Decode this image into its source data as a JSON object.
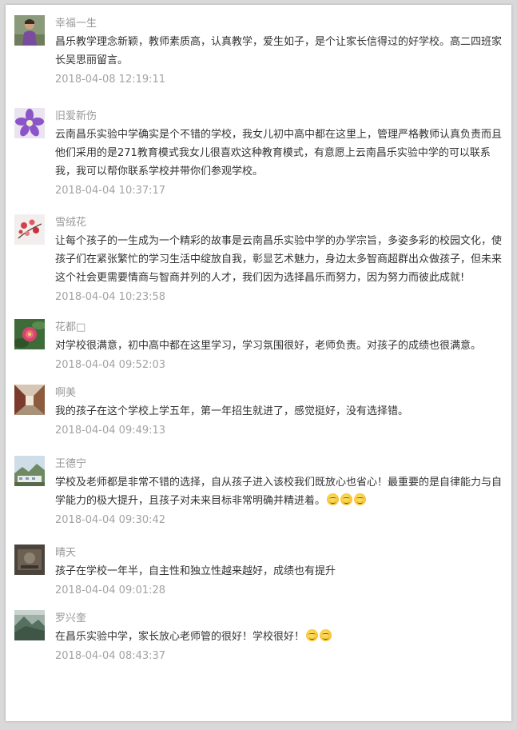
{
  "comments": [
    {
      "name": "幸福一生",
      "text": "昌乐教学理念新颖，教师素质高，认真教学，爱生如子，是个让家长信得过的好学校。高二四班家长吴思丽留言。",
      "time": "2018-04-08 12:19:11",
      "avatar_icon": "child-portrait-avatar"
    },
    {
      "name": "旧爱新伤",
      "text": "云南昌乐实验中学确实是个不错的学校，我女儿初中高中都在这里上，管理严格教师认真负责而且他们采用的是271教育模式我女儿很喜欢这种教育模式，有意愿上云南昌乐实验中学的可以联系我，我可以帮你联系学校并带你们参观学校。",
      "time": "2018-04-04 10:37:17",
      "avatar_icon": "purple-flower-avatar"
    },
    {
      "name": "雪绒花",
      "text": "让每个孩子的一生成为一个精彩的故事是云南昌乐实验中学的办学宗旨，多姿多彩的校园文化，使孩子们在紧张繁忙的学习生活中绽放自我，彰显艺术魅力，身边太多智商超群出众做孩子，但未来这个社会更需要情商与智商并列的人才，我们因为选择昌乐而努力，因为努力而彼此成就!",
      "time": "2018-04-04 10:23:58",
      "avatar_icon": "red-blossom-avatar"
    },
    {
      "name": "花都□",
      "text": "对学校很满意，初中高中都在这里学习，学习氛围很好，老师负责。对孩子的成绩也很满意。",
      "time": "2018-04-04 09:52:03",
      "avatar_icon": "pink-flower-avatar"
    },
    {
      "name": "啊美",
      "text": "我的孩子在这个学校上学五年，第一年招生就进了，感觉挺好，没有选择错。",
      "time": "2018-04-04 09:49:13",
      "avatar_icon": "corridor-avatar"
    },
    {
      "name": "王德宁",
      "text": "学校及老师都是非常不错的选择，自从孩子进入该校我们既放心也省心！最重要的是自律能力与自学能力的极大提升，且孩子对未来目标非常明确并精进着。",
      "emoji_count": 3,
      "time": "2018-04-04 09:30:42",
      "avatar_icon": "landscape-avatar"
    },
    {
      "name": "晴天",
      "text": "孩子在学校一年半，自主性和独立性越来越好，成绩也有提升",
      "time": "2018-04-04 09:01:28",
      "avatar_icon": "dark-photo-avatar"
    },
    {
      "name": "罗兴奎",
      "text": "在昌乐实验中学，家长放心老师管的很好！学校很好！",
      "emoji_count": 2,
      "time": "2018-04-04 08:43:37",
      "avatar_icon": "misty-mountain-avatar"
    }
  ]
}
